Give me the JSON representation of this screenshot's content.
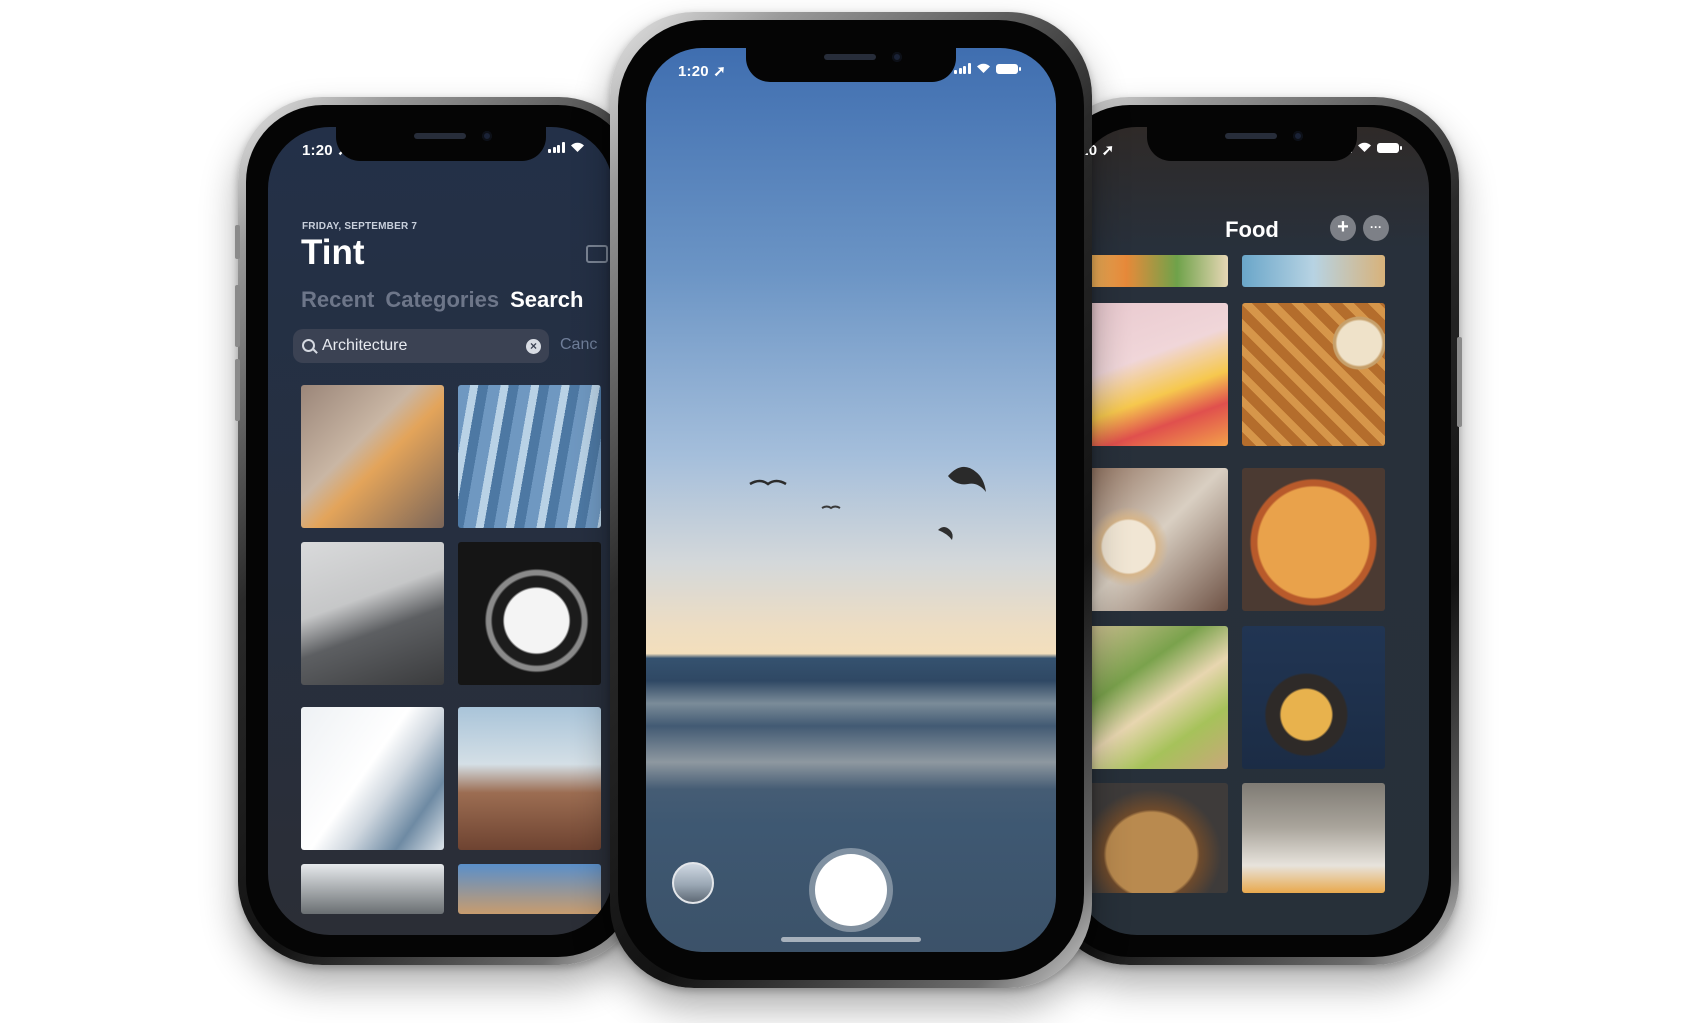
{
  "left_phone": {
    "status": {
      "time": "1:20 ➚"
    },
    "date": "FRIDAY, SEPTEMBER 7",
    "title": "Tint",
    "tabs": [
      {
        "label": "Recent",
        "active": false
      },
      {
        "label": "Categories",
        "active": false
      },
      {
        "label": "Search",
        "active": true
      }
    ],
    "search": {
      "value": "Architecture",
      "cancel_label": "Canc"
    },
    "photos": [
      "orange-atrium",
      "blue-glass-facade",
      "gray-curved-building",
      "bw-spiral-building",
      "white-balcony-building",
      "copper-sculpture-building",
      "trees-dome",
      "domed-building"
    ]
  },
  "center_phone": {
    "status": {
      "time": "1:20 ➚"
    },
    "scene": "camera-viewfinder-beach",
    "controls": {
      "shutter": "shutter-button",
      "gallery": "gallery-thumbnail"
    }
  },
  "right_phone": {
    "status": {
      "time": ":20 ➚"
    },
    "title": "Food",
    "add_icon": "+",
    "more_icon": "···",
    "photos": [
      "food-bowl",
      "waffles-top",
      "pineapple-fruit",
      "waffles-pecans",
      "yogurt-granola",
      "pizza",
      "tacos-lime",
      "blueberry-pancake",
      "bread-loaf",
      "street-cafe"
    ]
  },
  "colors": {
    "left_bg": "#233048",
    "right_bg": "#273039",
    "accent_inactive": "#6d7689",
    "cancel": "#6f7e99"
  }
}
